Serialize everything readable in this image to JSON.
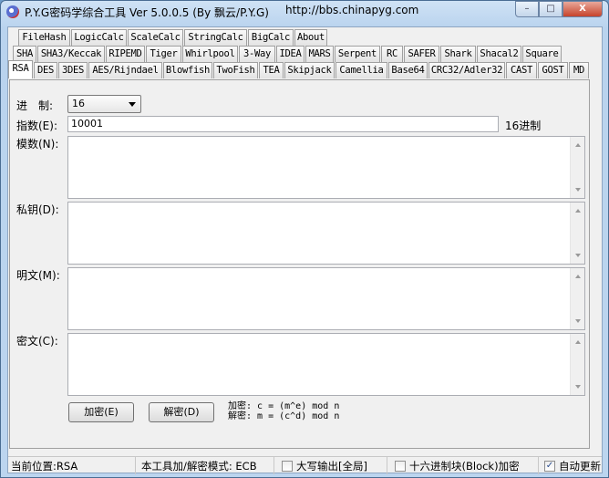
{
  "window": {
    "title": "P.Y.G密码学综合工具 Ver 5.0.0.5 (By 飘云/P.Y.G)",
    "url": "http://bbs.chinapyg.com",
    "minimize": "–",
    "maximize": "□",
    "close": "X"
  },
  "tabs": {
    "row1": [
      "FileHash",
      "LogicCalc",
      "ScaleCalc",
      "StringCalc",
      "BigCalc",
      "About"
    ],
    "row2": [
      "SHA",
      "SHA3/Keccak",
      "RIPEMD",
      "Tiger",
      "Whirlpool",
      "3-Way",
      "IDEA",
      "MARS",
      "Serpent",
      "RC",
      "SAFER",
      "Shark",
      "Shacal2",
      "Square"
    ],
    "row3": [
      "RSA",
      "DES",
      "3DES",
      "AES/Rijndael",
      "Blowfish",
      "TwoFish",
      "TEA",
      "Skipjack",
      "Camellia",
      "Base64",
      "CRC32/Adler32",
      "CAST",
      "GOST",
      "MD"
    ],
    "selected": "RSA"
  },
  "form": {
    "radix_label": "进　制:",
    "radix_value": "16",
    "exponent_label": "指数(E):",
    "exponent_value": "10001",
    "exponent_suffix": "16进制",
    "modulus_label": "模数(N):",
    "private_key_label": "私钥(D):",
    "plaintext_label": "明文(M):",
    "ciphertext_label": "密文(C):",
    "modulus_value": "",
    "private_key_value": "",
    "plaintext_value": "",
    "ciphertext_value": ""
  },
  "buttons": {
    "encrypt": "加密(E)",
    "decrypt": "解密(D)"
  },
  "formula": {
    "encrypt": "加密: c = (m^e) mod n",
    "decrypt": "解密: m = (c^d) mod n"
  },
  "status": {
    "location": "当前位置:RSA",
    "mode": "本工具加/解密模式: ECB",
    "uppercase": "大写输出[全局]",
    "uppercase_checked": false,
    "hex_block": "十六进制块(Block)加密",
    "hex_block_checked": false,
    "auto_update": "自动更新",
    "auto_update_checked": true
  }
}
